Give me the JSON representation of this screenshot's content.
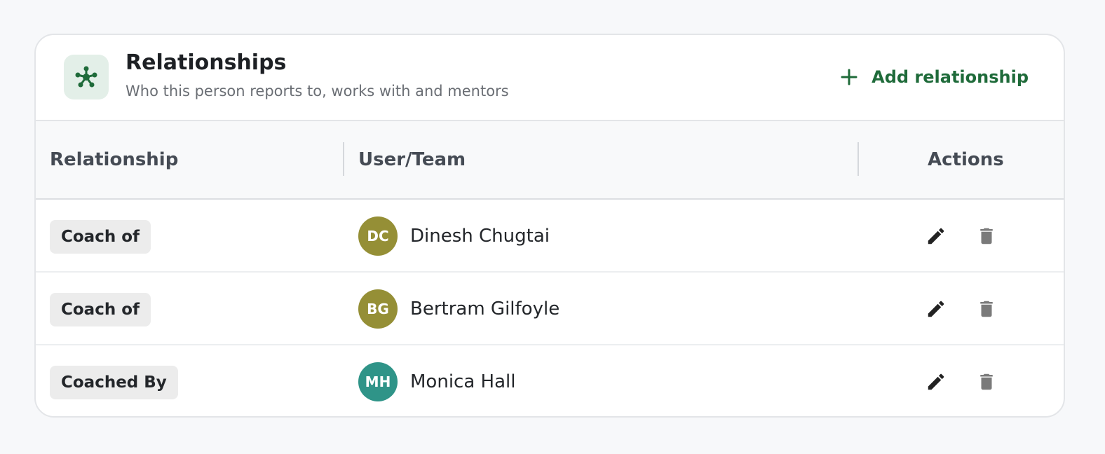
{
  "header": {
    "icon": "network-icon",
    "title": "Relationships",
    "subtitle": "Who this person reports to, works with and mentors",
    "add_label": "Add relationship"
  },
  "table": {
    "columns": [
      "Relationship",
      "User/Team",
      "Actions"
    ],
    "rows": [
      {
        "relationship": "Coach of",
        "initials": "DC",
        "name": "Dinesh Chugtai",
        "avatar_color": "#958f36"
      },
      {
        "relationship": "Coach of",
        "initials": "BG",
        "name": "Bertram Gilfoyle",
        "avatar_color": "#958f36"
      },
      {
        "relationship": "Coached By",
        "initials": "MH",
        "name": "Monica Hall",
        "avatar_color": "#2f9488"
      }
    ]
  },
  "colors": {
    "accent": "#1f6b3a",
    "edit_icon": "#222222",
    "delete_icon": "#7a7a7a"
  },
  "icons": {
    "edit": "pencil-icon",
    "delete": "trash-icon",
    "add": "plus-icon"
  }
}
